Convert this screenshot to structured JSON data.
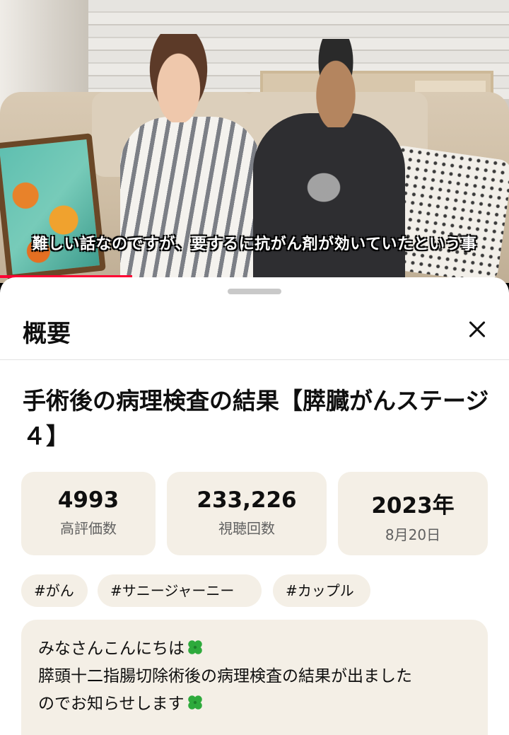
{
  "video": {
    "subtitle": "難しい話なのですが、要するに抗がん剤が効いていたという事",
    "progress": 0.26
  },
  "sheet": {
    "header_title": "概要",
    "close_icon": "close-icon",
    "video_title": "手術後の病理検査の結果【膵臓がんステージ４】",
    "stats": [
      {
        "value": "4993",
        "label": "高評価数"
      },
      {
        "value": "233,226",
        "label": "視聴回数"
      },
      {
        "value": "2023年",
        "label": "8月20日"
      }
    ],
    "tags": [
      "#がん",
      "#サニージャーニー",
      "#カップル"
    ],
    "description": {
      "line1": "みなさんこんにちは",
      "line2": "膵頭十二指腸切除術後の病理検査の結果が出ました",
      "line3": "のでお知らせします",
      "emoji_icon": "four-leaf-clover-icon"
    }
  },
  "colors": {
    "chip_background": "#f4efe6",
    "progress_red": "#ff0033",
    "clover_green": "#2eaa3c"
  }
}
